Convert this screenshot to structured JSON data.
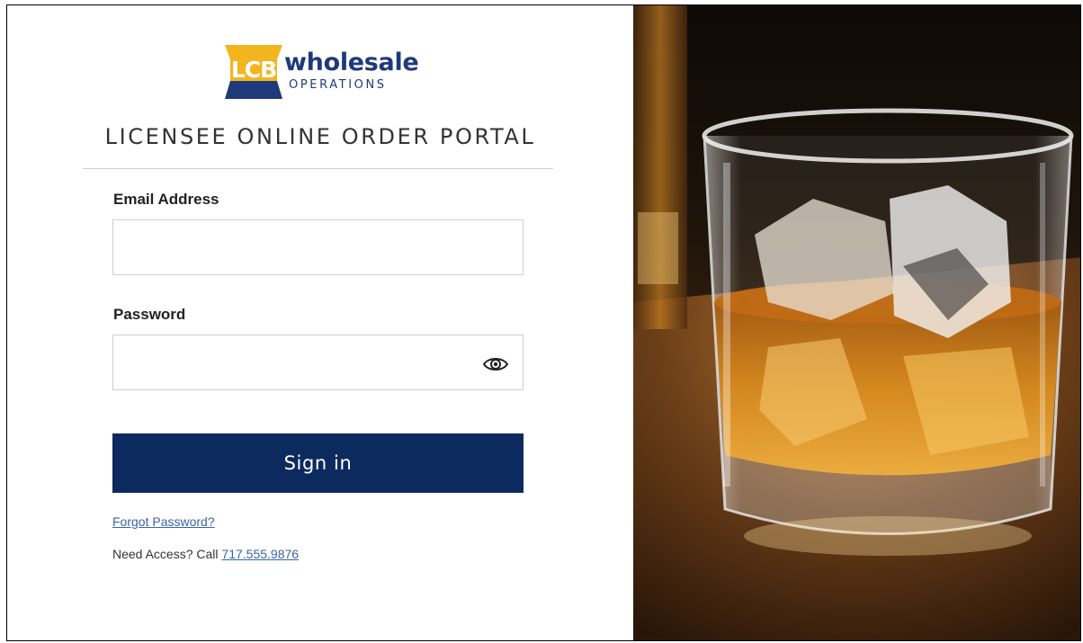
{
  "logo": {
    "badge_text": "LCB",
    "brand": "wholesale",
    "sub": "OPERATIONS",
    "colors": {
      "keystone": "#f2b51d",
      "navy": "#1f3a7a"
    }
  },
  "title": "LICENSEE ONLINE ORDER PORTAL",
  "form": {
    "email_label": "Email Address",
    "email_value": "",
    "password_label": "Password",
    "password_value": "",
    "password_toggle_icon": "eye-icon",
    "signin_label": "Sign in"
  },
  "links": {
    "forgot": "Forgot Password?",
    "access_prefix": "Need Access? Call",
    "phone": "717.555.9876"
  },
  "colors": {
    "primary": "#0d2a5f",
    "link": "#3a63a8"
  },
  "hero_image": "whiskey-glass-photo"
}
